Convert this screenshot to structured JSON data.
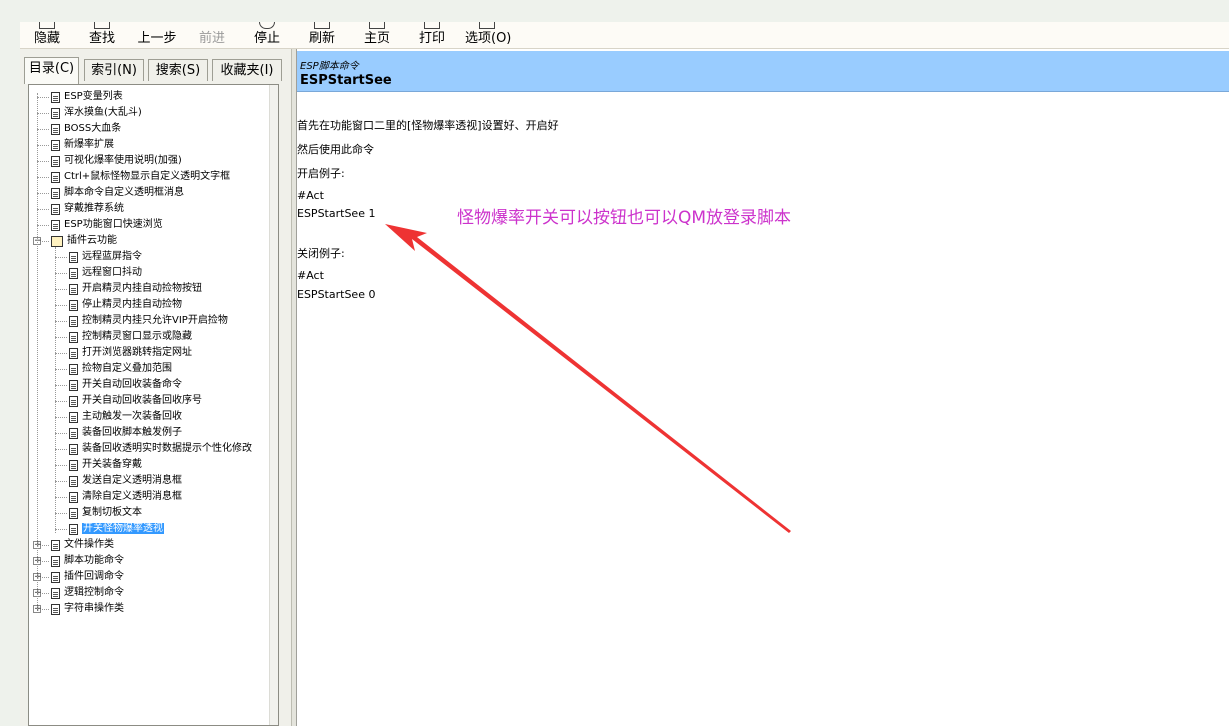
{
  "toolbar": {
    "hide": "隐藏",
    "find": "查找",
    "back": "上一步",
    "forward": "前进",
    "stop": "停止",
    "refresh": "刷新",
    "home": "主页",
    "print": "打印",
    "options": "选项(O)"
  },
  "tabs": {
    "contents": "目录(C)",
    "index": "索引(N)",
    "search": "搜索(S)",
    "favorites": "收藏夹(I)"
  },
  "tree": {
    "top_items": [
      "ESP变量列表",
      "浑水摸鱼(大乱斗)",
      "BOSS大血条",
      "新爆率扩展",
      "可视化爆率使用说明(加强)",
      "Ctrl+鼠标怪物显示自定义透明文字框",
      "脚本命令自定义透明框消息",
      "穿戴推荐系统",
      "ESP功能窗口快速浏览"
    ],
    "folder": "插件云功能",
    "folder_items": [
      "远程蓝屏指令",
      "远程窗口抖动",
      "开启精灵内挂自动捡物按钮",
      "停止精灵内挂自动捡物",
      "控制精灵内挂只允许VIP开启捡物",
      "控制精灵窗口显示或隐藏",
      "打开浏览器跳转指定网址",
      "捡物自定义叠加范围",
      "开关自动回收装备命令",
      "开关自动回收装备回收序号",
      "主动触发一次装备回收",
      "装备回收脚本触发例子",
      "装备回收透明实时数据提示个性化修改",
      "开关装备穿戴",
      "发送自定义透明消息框",
      "清除自定义透明消息框",
      "复制切板文本",
      "开关怪物爆率透视"
    ],
    "bottom_items": [
      "文件操作类",
      "脚本功能命令",
      "插件回调命令",
      "逻辑控制命令",
      "字符串操作类"
    ]
  },
  "topic": {
    "breadcrumb": "ESP脚本命令",
    "title": "ESPStartSee",
    "lines": [
      "首先在功能窗口二里的[怪物爆率透视]设置好、开启好",
      "然后使用此命令",
      "开启例子:",
      "#Act",
      "ESPStartSee 1",
      "关闭例子:",
      "#Act",
      "ESPStartSee 0"
    ],
    "annotation": "怪物爆率开关可以按钮也可以QM放登录脚本"
  },
  "colors": {
    "header_bg": "#99ccff",
    "selection": "#3399ff",
    "annotation": "#cc33cc",
    "arrow": "#ee3333"
  }
}
